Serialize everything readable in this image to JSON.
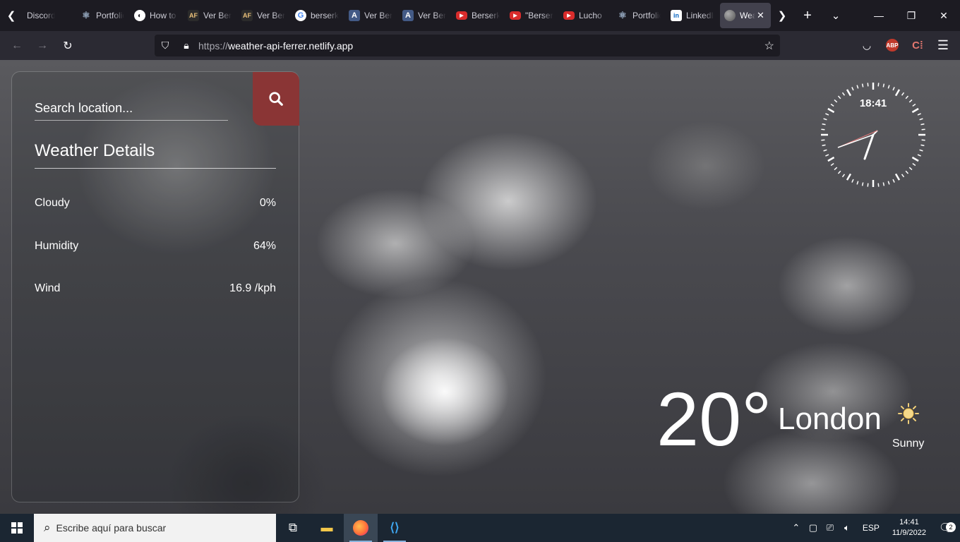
{
  "browser": {
    "tabs": [
      {
        "label": "Discord",
        "icon": "discord-icon"
      },
      {
        "label": "Portfolio",
        "icon": "react-icon"
      },
      {
        "label": "How to",
        "icon": "site-icon"
      },
      {
        "label": "Ver Berserk",
        "icon": "af-icon"
      },
      {
        "label": "Ver Berserk",
        "icon": "af-icon"
      },
      {
        "label": "berserk",
        "icon": "google-icon"
      },
      {
        "label": "Ver Berserk",
        "icon": "a-icon"
      },
      {
        "label": "Ver Berserk",
        "icon": "a-icon"
      },
      {
        "label": "Berserk",
        "icon": "youtube-icon"
      },
      {
        "label": "\"Berserk",
        "icon": "youtube-icon"
      },
      {
        "label": "Lucho",
        "icon": "youtube-icon"
      },
      {
        "label": "Portfolio",
        "icon": "react-icon"
      },
      {
        "label": "LinkedIn",
        "icon": "linkedin-icon"
      },
      {
        "label": "Weather",
        "icon": "globe-icon",
        "active": true
      }
    ],
    "url_scheme": "https://",
    "url_host": "weather-api-ferrer.netlify.app",
    "abp_label": "ABP"
  },
  "app": {
    "search_placeholder": "Search location...",
    "details_title": "Weather Details",
    "details": [
      {
        "label": "Cloudy",
        "value": "0%"
      },
      {
        "label": "Humidity",
        "value": "64%"
      },
      {
        "label": "Wind",
        "value": "16.9 /kph"
      }
    ],
    "clock_time": "18:41",
    "temperature": "20°",
    "city": "London",
    "condition": "Sunny",
    "accent_color": "#8a3535"
  },
  "taskbar": {
    "search_placeholder": "Escribe aquí para buscar",
    "language": "ESP",
    "time": "14:41",
    "date": "11/9/2022",
    "notification_count": "2"
  }
}
